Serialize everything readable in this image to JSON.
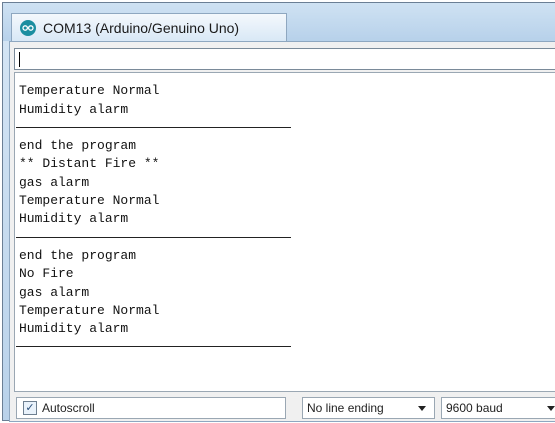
{
  "window": {
    "title": "COM13 (Arduino/Genuino Uno)",
    "icon": "arduino-infinity-icon",
    "accent_color": "#1b8ea0"
  },
  "send": {
    "value": ""
  },
  "output": {
    "lines": [
      {
        "type": "text",
        "text": "Temperature Normal"
      },
      {
        "type": "text",
        "text": "Humidity alarm"
      },
      {
        "type": "separator"
      },
      {
        "type": "text",
        "text": "end the program"
      },
      {
        "type": "text",
        "text": "** Distant Fire **"
      },
      {
        "type": "text",
        "text": "gas alarm"
      },
      {
        "type": "text",
        "text": "Temperature Normal"
      },
      {
        "type": "text",
        "text": "Humidity alarm"
      },
      {
        "type": "separator"
      },
      {
        "type": "text",
        "text": "end the program"
      },
      {
        "type": "text",
        "text": "No Fire"
      },
      {
        "type": "text",
        "text": "gas alarm"
      },
      {
        "type": "text",
        "text": "Temperature Normal"
      },
      {
        "type": "text",
        "text": "Humidity alarm"
      },
      {
        "type": "separator"
      }
    ]
  },
  "footer": {
    "autoscroll_label": "Autoscroll",
    "autoscroll_checked": true,
    "line_ending": "No line ending",
    "baud_rate": "9600 baud"
  }
}
